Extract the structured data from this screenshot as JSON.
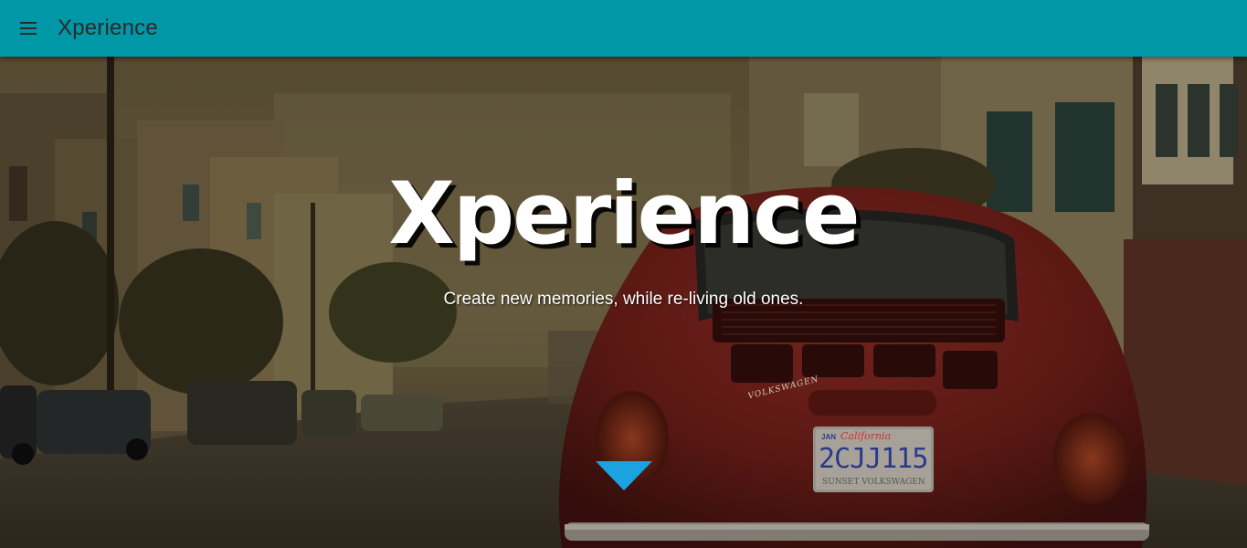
{
  "app_bar": {
    "title": "Xperience",
    "menu_icon": "hamburger-menu-icon",
    "background_color": "#0097a7"
  },
  "hero": {
    "title": "Xperience",
    "tagline": "Create new memories, while re-living old ones.",
    "background_description_icon": "street-with-red-car-photo",
    "scroll_icon": "down-triangle-icon",
    "scroll_icon_color": "#1aa3e0"
  },
  "plate": {
    "number": "2CJJ115",
    "state": "California",
    "month": "JAN",
    "frame_text": "SUNSET VOLKSWAGEN"
  },
  "car_badge": "VOLKSWAGEN"
}
